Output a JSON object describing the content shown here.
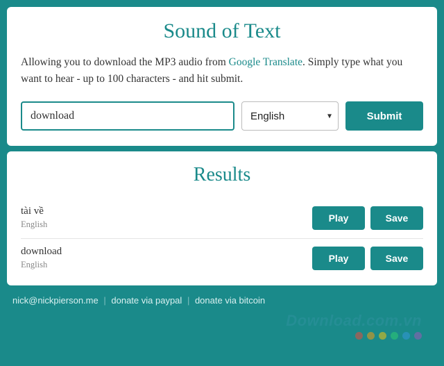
{
  "header": {
    "title": "Sound of Text",
    "desc_before": "Allowing you to download the MP3 audio from ",
    "desc_link": "Google Translate",
    "desc_after": ". Simply type what you want to hear - up to 100 characters - and hit submit."
  },
  "form": {
    "text_value": "download",
    "language_selected": "English",
    "submit_label": "Submit"
  },
  "results": {
    "title": "Results",
    "items": [
      {
        "text": "tài về",
        "lang": "English",
        "play_label": "Play",
        "save_label": "Save"
      },
      {
        "text": "download",
        "lang": "English",
        "play_label": "Play",
        "save_label": "Save"
      }
    ]
  },
  "footer": {
    "email": "nick@nickpierson.me",
    "link1": "donate via paypal",
    "link2": "donate via bitcoin"
  },
  "watermark": {
    "text": "Download.com.vn",
    "dot_colors": [
      "#e74c3c",
      "#f39c12",
      "#f1c40f",
      "#2ecc71",
      "#3498db",
      "#9b59b6"
    ]
  }
}
